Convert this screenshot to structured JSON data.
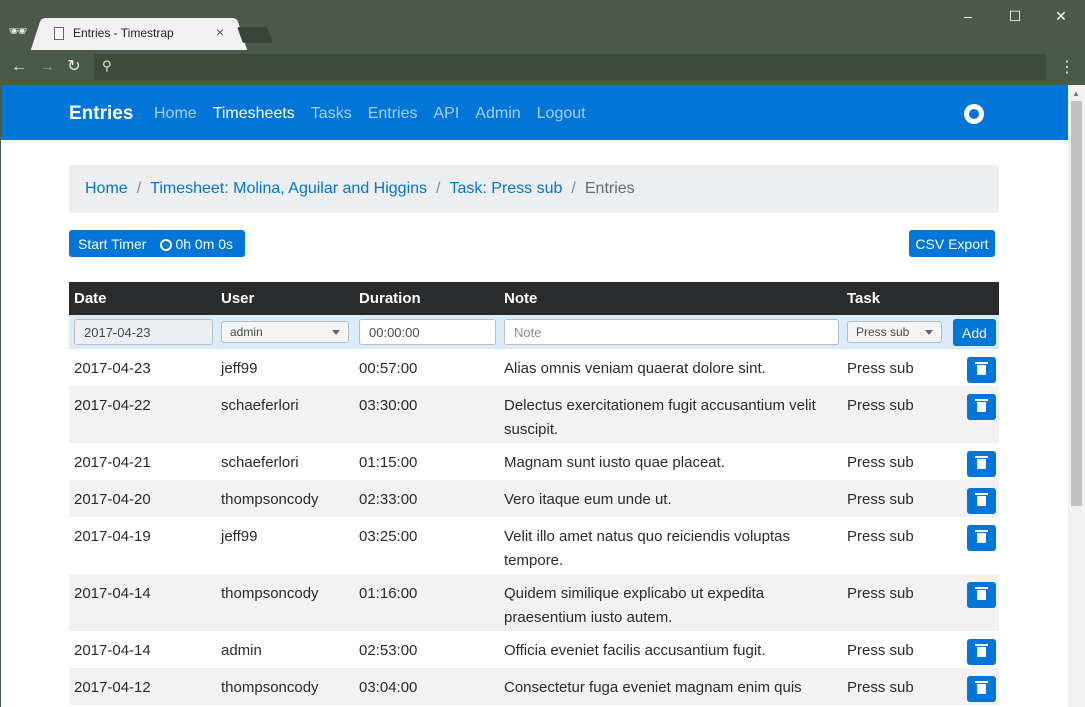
{
  "browser": {
    "tab_title": "Entries - Timestrap",
    "tab_close": "×",
    "window_buttons": [
      "–",
      "☐",
      "✕"
    ],
    "nav": {
      "back": "←",
      "forward": "→",
      "reload": "↻"
    },
    "menu": "⋮"
  },
  "navbar": {
    "brand": "Entries",
    "links": [
      {
        "label": "Home",
        "active": false
      },
      {
        "label": "Timesheets",
        "active": true
      },
      {
        "label": "Tasks",
        "active": false
      },
      {
        "label": "Entries",
        "active": false
      },
      {
        "label": "API",
        "active": false
      },
      {
        "label": "Admin",
        "active": false
      },
      {
        "label": "Logout",
        "active": false
      }
    ],
    "github_icon": "github-icon",
    "color": "#0275d8"
  },
  "breadcrumb": {
    "items": [
      "Home",
      "Timesheet: Molina, Aguilar and Higgins",
      "Task: Press sub"
    ],
    "current": "Entries",
    "separator": "/"
  },
  "actions": {
    "start_timer": "Start Timer",
    "elapsed": "0h 0m 0s",
    "csv_export": "CSV Export"
  },
  "table": {
    "headers": [
      "Date",
      "User",
      "Duration",
      "Note",
      "Task"
    ],
    "form": {
      "date": "2017-04-23",
      "user": "admin",
      "duration": "00:00:00",
      "note_placeholder": "Note",
      "task": "Press sub",
      "add_label": "Add"
    },
    "rows": [
      {
        "date": "2017-04-23",
        "user": "jeff99",
        "duration": "00:57:00",
        "note": "Alias omnis veniam quaerat dolore sint.",
        "task": "Press sub"
      },
      {
        "date": "2017-04-22",
        "user": "schaeferlori",
        "duration": "03:30:00",
        "note": "Delectus exercitationem fugit accusantium velit suscipit.",
        "task": "Press sub"
      },
      {
        "date": "2017-04-21",
        "user": "schaeferlori",
        "duration": "01:15:00",
        "note": "Magnam sunt iusto quae placeat.",
        "task": "Press sub"
      },
      {
        "date": "2017-04-20",
        "user": "thompsoncody",
        "duration": "02:33:00",
        "note": "Vero itaque eum unde ut.",
        "task": "Press sub"
      },
      {
        "date": "2017-04-19",
        "user": "jeff99",
        "duration": "03:25:00",
        "note": "Velit illo amet natus quo reiciendis voluptas tempore.",
        "task": "Press sub"
      },
      {
        "date": "2017-04-14",
        "user": "thompsoncody",
        "duration": "01:16:00",
        "note": "Quidem similique explicabo ut expedita praesentium iusto autem.",
        "task": "Press sub"
      },
      {
        "date": "2017-04-14",
        "user": "admin",
        "duration": "02:53:00",
        "note": "Officia eveniet facilis accusantium fugit.",
        "task": "Press sub"
      },
      {
        "date": "2017-04-12",
        "user": "thompsoncody",
        "duration": "03:04:00",
        "note": "Consectetur fuga eveniet magnam enim quis",
        "task": "Press sub"
      }
    ]
  }
}
